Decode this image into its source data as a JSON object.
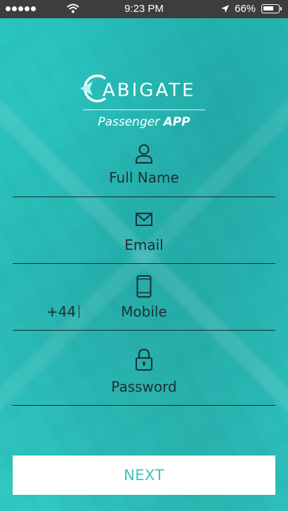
{
  "status_bar": {
    "time": "9:23 PM",
    "battery": "66%"
  },
  "logo": {
    "text": "ABIGATE"
  },
  "subtitle": {
    "regular": "Passenger ",
    "bold": "APP"
  },
  "form": {
    "full_name_placeholder": "Full Name",
    "email_placeholder": "Email",
    "mobile_prefix": "+44",
    "mobile_placeholder": "Mobile",
    "password_placeholder": "Password"
  },
  "next_button": {
    "label": "NEXT"
  },
  "colors": {
    "accent": "#3cc4c0",
    "status_bar": "#3d3d3d",
    "text": "#1e2f30"
  },
  "icons": [
    "user-icon",
    "envelope-icon",
    "phone-icon",
    "lock-icon",
    "wifi-icon",
    "location-arrow-icon",
    "battery-icon"
  ]
}
